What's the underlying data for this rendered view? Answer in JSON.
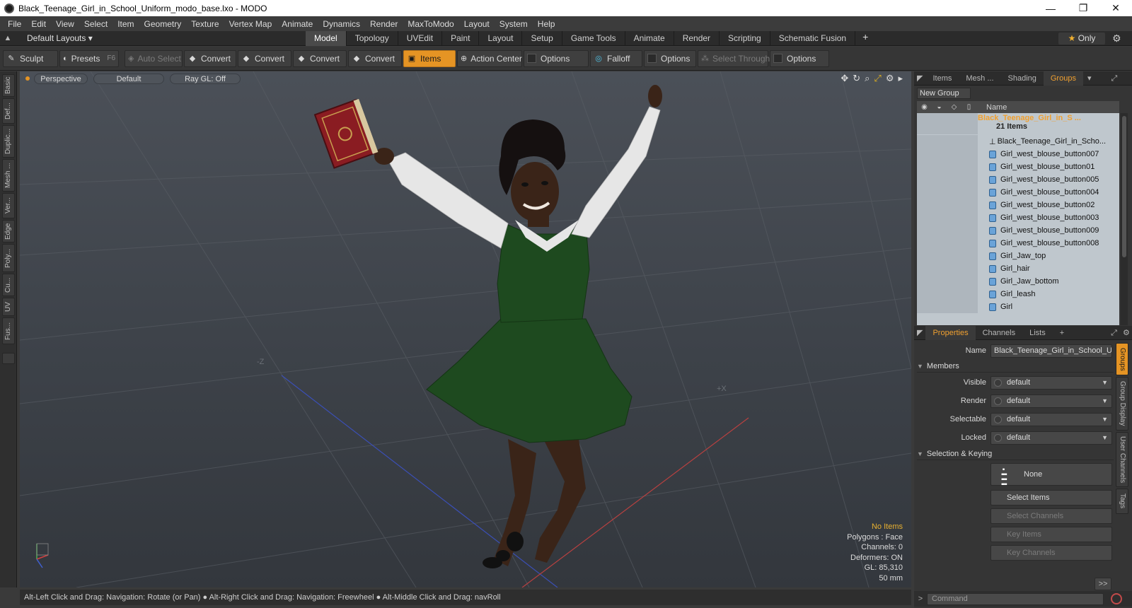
{
  "window": {
    "title": "Black_Teenage_Girl_in_School_Uniform_modo_base.lxo - MODO",
    "minimize": "—",
    "maximize": "❐",
    "close": "✕"
  },
  "menu": [
    "File",
    "Edit",
    "View",
    "Select",
    "Item",
    "Geometry",
    "Texture",
    "Vertex Map",
    "Animate",
    "Dynamics",
    "Render",
    "MaxToModo",
    "Layout",
    "System",
    "Help"
  ],
  "layoutbar": {
    "layout_select": "Default Layouts ▾",
    "tabs": [
      "Model",
      "Topology",
      "UVEdit",
      "Paint",
      "Layout",
      "Setup",
      "Game Tools",
      "Animate",
      "Render",
      "Scripting",
      "Schematic Fusion"
    ],
    "active_tab": "Model",
    "only_label": "Only"
  },
  "toolbar": {
    "sculpt": "Sculpt",
    "presets": "Presets",
    "presets_key": "F6",
    "auto_select": "Auto Select",
    "convert1": "Convert",
    "convert2": "Convert",
    "convert3": "Convert",
    "convert4": "Convert",
    "items": "Items",
    "action_center": "Action Center",
    "options1": "Options",
    "falloff": "Falloff",
    "options2": "Options",
    "select_through": "Select Through",
    "options3": "Options"
  },
  "left_tabs": [
    "Basic",
    "Def...",
    "Duplic...",
    "Mesh ...",
    "Ver...",
    "Edge",
    "Poly...",
    "Cu...",
    "UV",
    "Fus..."
  ],
  "viewport": {
    "view": "Perspective",
    "shading": "Default",
    "raygl": "Ray GL: Off",
    "info": {
      "selection": "No Items",
      "polygons": "Polygons : Face",
      "channels": "Channels: 0",
      "deformers": "Deformers: ON",
      "gl": "GL: 85,310",
      "lens": "50 mm"
    },
    "axis_labels": {
      "neg_z": "-Z",
      "pos_x": "+X"
    },
    "colors": {
      "skirt": "#1e4a1f",
      "shirt": "#e6e6e6",
      "skin": "#3a2418",
      "book": "#8a1c22"
    }
  },
  "statusbar": {
    "text": "Alt-Left Click and Drag: Navigation: Rotate (or Pan) ● Alt-Right Click and Drag: Navigation: Freewheel ● Alt-Middle Click and Drag: navRoll"
  },
  "groups_panel": {
    "tabs": [
      "Items",
      "Mesh ...",
      "Shading",
      "Groups"
    ],
    "active_tab": "Groups",
    "new_group": "New Group",
    "name_header": "Name",
    "group_name": "Black_Teenage_Girl_in_S ...",
    "group_count": "21 Items",
    "items": [
      "Black_Teenage_Girl_in_Scho...",
      "Girl_west_blouse_button007",
      "Girl_west_blouse_button01",
      "Girl_west_blouse_button005",
      "Girl_west_blouse_button004",
      "Girl_west_blouse_button02",
      "Girl_west_blouse_button003",
      "Girl_west_blouse_button009",
      "Girl_west_blouse_button008",
      "Girl_Jaw_top",
      "Girl_hair",
      "Girl_Jaw_bottom",
      "Girl_leash",
      "Girl"
    ]
  },
  "properties_panel": {
    "tabs": [
      "Properties",
      "Channels",
      "Lists"
    ],
    "active_tab": "Properties",
    "name_label": "Name",
    "name_value": "Black_Teenage_Girl_in_School_Ur",
    "members_label": "Members",
    "visible_label": "Visible",
    "visible_value": "default",
    "render_label": "Render",
    "render_value": "default",
    "selectable_label": "Selectable",
    "selectable_value": "default",
    "locked_label": "Locked",
    "locked_value": "default",
    "selection_keying": "Selection & Keying",
    "none_button": "None",
    "select_items": "Select Items",
    "select_channels": "Select Channels",
    "key_items": "Key Items",
    "key_channels": "Key Channels",
    "more": ">>",
    "side_tabs": [
      "Groups",
      "Group Display",
      "User Channels",
      "Tags"
    ]
  },
  "command": {
    "placeholder": "Command"
  }
}
